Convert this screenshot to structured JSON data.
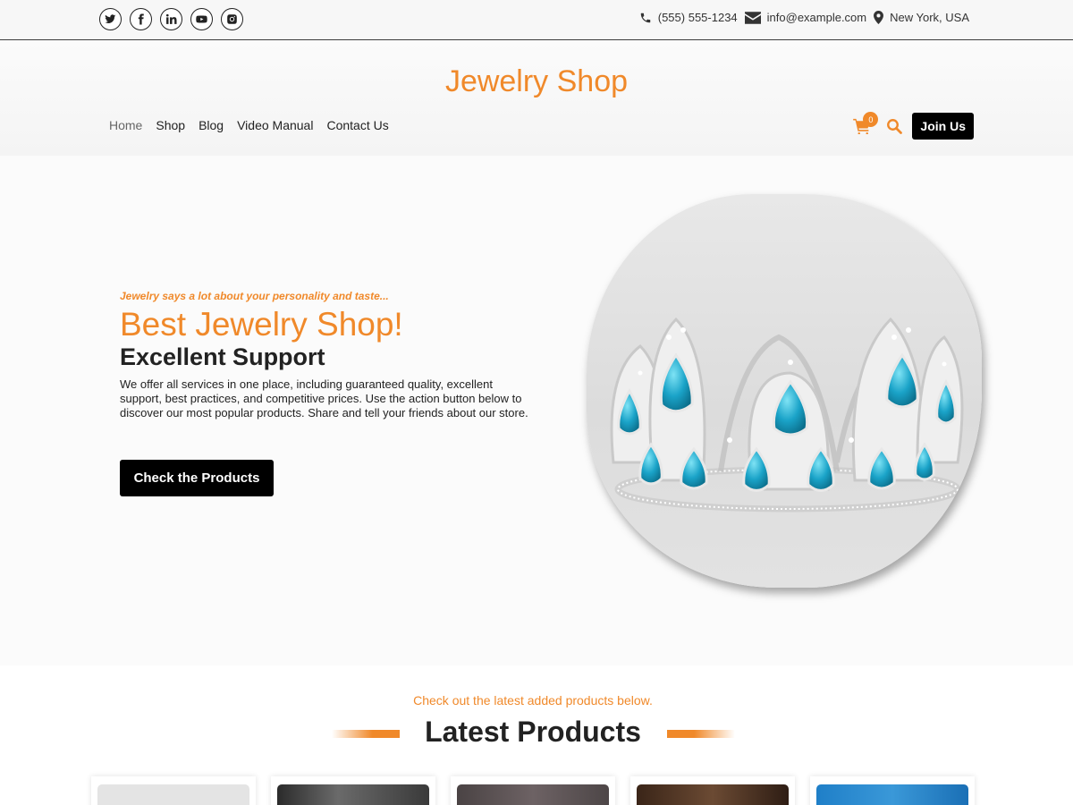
{
  "topbar": {
    "social": [
      {
        "name": "twitter-icon"
      },
      {
        "name": "facebook-icon"
      },
      {
        "name": "linkedin-icon"
      },
      {
        "name": "youtube-icon"
      },
      {
        "name": "instagram-icon"
      }
    ],
    "phone": "(555) 555-1234",
    "email": "info@example.com",
    "location": "New York, USA"
  },
  "header": {
    "brand": "Jewelry Shop",
    "nav": [
      "Home",
      "Shop",
      "Blog",
      "Video Manual",
      "Contact Us"
    ],
    "active_nav": "Home",
    "cart_count": "0",
    "join_label": "Join Us"
  },
  "hero": {
    "tagline": "Jewelry says a lot about your personality and taste...",
    "title": "Best Jewelry Shop!",
    "subtitle": "Excellent Support",
    "text": "We offer all services in one place, including guaranteed quality, excellent support, best practices, and competitive prices. Use the action button below to discover our most popular products. Share and tell your friends about our store.",
    "button_label": "Check the Products"
  },
  "latest": {
    "intro": "Check out the latest added products below.",
    "title": "Latest Products"
  },
  "colors": {
    "accent": "#f0892a",
    "dark": "#000000",
    "text": "#222222"
  }
}
